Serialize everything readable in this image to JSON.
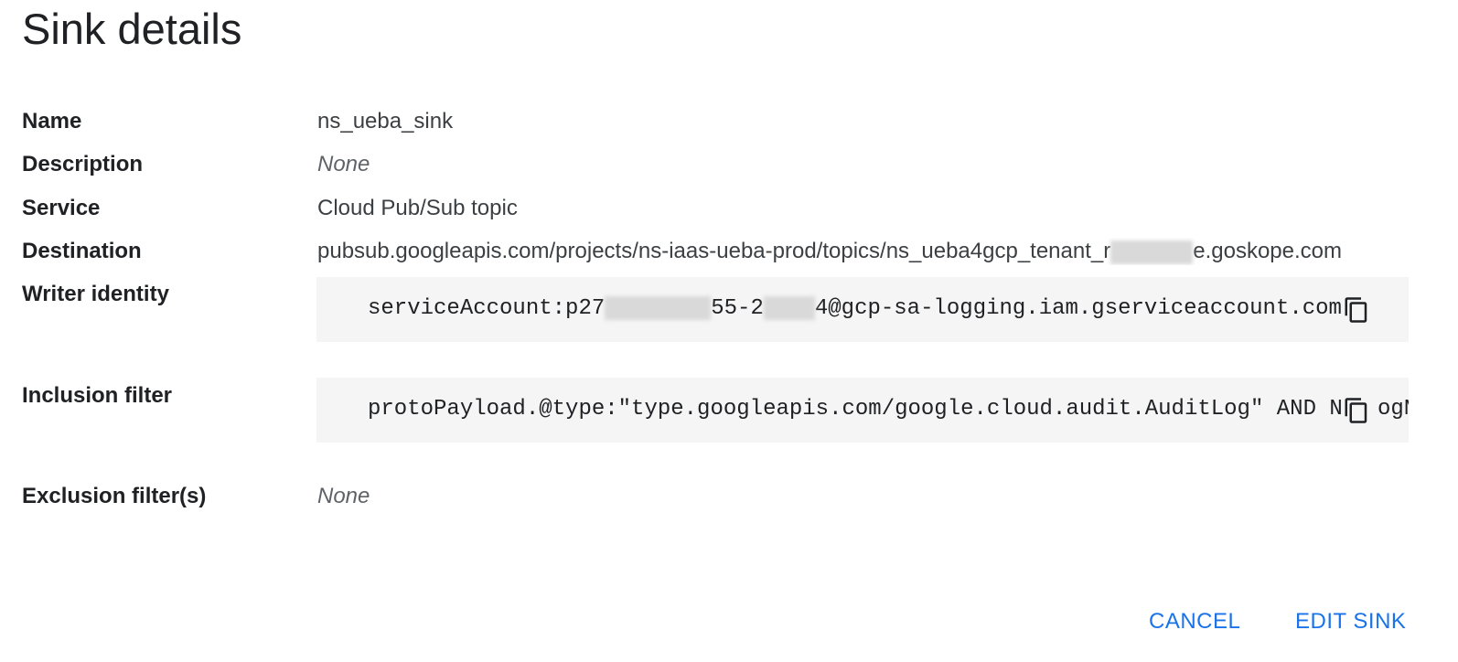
{
  "title": "Sink details",
  "fields": {
    "name": {
      "label": "Name",
      "value": "ns_ueba_sink"
    },
    "description": {
      "label": "Description",
      "value": "None"
    },
    "service": {
      "label": "Service",
      "value": "Cloud Pub/Sub topic"
    },
    "destination": {
      "label": "Destination",
      "value_prefix": "pubsub.googleapis.com/projects/ns-iaas-ueba-prod/topics/ns_ueba4gcp_tenant_r",
      "value_suffix": "e.goskope.com"
    },
    "writer_identity": {
      "label": "Writer identity",
      "part1": "serviceAccount:p27",
      "part2": "55-2",
      "part3": "4@gcp-sa-logging.iam.gserviceaccount.com"
    },
    "inclusion_filter": {
      "label": "Inclusion filter",
      "value": "protoPayload.@type:\"type.googleapis.com/google.cloud.audit.AuditLog\" AND NO",
      "overflow_tail": "ogN"
    },
    "exclusion_filters": {
      "label": "Exclusion filter(s)",
      "value": "None"
    }
  },
  "icons": {
    "copy": "copy-icon"
  },
  "actions": {
    "cancel": "CANCEL",
    "edit": "EDIT SINK"
  },
  "colors": {
    "accent": "#1a73e8",
    "code_bg": "#f5f5f5"
  }
}
